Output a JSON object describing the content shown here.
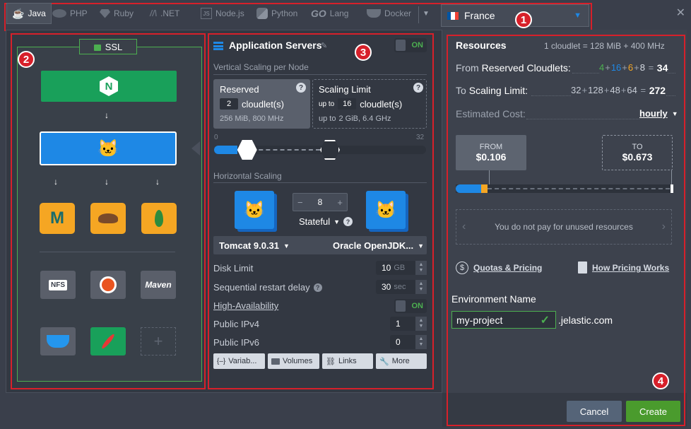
{
  "tabs": [
    {
      "label": "Java",
      "icon": "java-icon"
    },
    {
      "label": "PHP",
      "icon": "php-icon"
    },
    {
      "label": "Ruby",
      "icon": "ruby-icon"
    },
    {
      "label": ".NET",
      "icon": "dotnet-icon"
    },
    {
      "label": "Node.js",
      "icon": "nodejs-icon"
    },
    {
      "label": "Python",
      "icon": "python-icon"
    },
    {
      "label": "Lang",
      "icon": "go-icon",
      "logo": "GO"
    },
    {
      "label": "Docker",
      "icon": "docker-icon"
    }
  ],
  "region": {
    "label": "France",
    "flag_colors": [
      "#0055a4",
      "#ffffff",
      "#ef4135"
    ]
  },
  "badges": [
    "1",
    "2",
    "3",
    "4"
  ],
  "topology": {
    "ssl_label": "SSL",
    "nginx_letter": "N",
    "nfs_label": "NFS",
    "maven_label": "Maven",
    "add_symbol": "+"
  },
  "app_servers": {
    "title": "Application Servers",
    "toggle": "ON",
    "vertical_title": "Vertical Scaling per Node",
    "reserved": {
      "label": "Reserved",
      "count": "2",
      "unit": "cloudlet(s)",
      "details": "256 MiB, 800 MHz"
    },
    "scaling_limit": {
      "label": "Scaling Limit",
      "prefix": "up to",
      "count": "16",
      "unit": "cloudlet(s)",
      "details_prefix": "up to",
      "details": "2 GiB, 6.4 GHz"
    },
    "slider": {
      "min_label": "0",
      "max_label": "32",
      "reserved_value": 2,
      "limit_value": 16,
      "max": 32
    },
    "horizontal_title": "Horizontal Scaling",
    "node_count": "8",
    "mode": "Stateful",
    "server_version": "Tomcat 9.0.31",
    "jdk_version": "Oracle OpenJDK...",
    "disk_limit": {
      "label": "Disk Limit",
      "value": "10",
      "unit": "GB"
    },
    "restart_delay": {
      "label": "Sequential restart delay",
      "value": "30",
      "unit": "sec"
    },
    "ha": {
      "label": "High-Availability",
      "toggle": "ON"
    },
    "ipv4": {
      "label": "Public IPv4",
      "value": "1"
    },
    "ipv6": {
      "label": "Public IPv6",
      "value": "0"
    },
    "buttons": {
      "variables": "Variab...",
      "volumes": "Volumes",
      "links": "Links",
      "more": "More"
    }
  },
  "resources": {
    "title": "Resources",
    "cloudlet_def": "1 cloudlet = 128 MiB + 400 MHz",
    "from_label": "From",
    "from_label_strong": "Reserved Cloudlets:",
    "from_parts": [
      "4",
      "16",
      "6",
      "8"
    ],
    "from_total": "34",
    "from_colors": [
      "#4caf50",
      "#1e88e5",
      "#f5a623",
      "#d6dbe3"
    ],
    "to_label": "To",
    "to_label_strong": "Scaling Limit:",
    "to_parts": [
      "32",
      "128",
      "48",
      "64"
    ],
    "to_total": "272",
    "estimated_label": "Estimated Cost:",
    "period": "hourly",
    "from_box": {
      "label": "FROM",
      "value": "$0.106"
    },
    "to_box": {
      "label": "TO",
      "value": "$0.673"
    },
    "unused_note": "You do not pay for unused resources",
    "quotas_link": "Quotas & Pricing",
    "pricing_link": "How Pricing Works",
    "env_label": "Environment Name",
    "env_value": "my-project",
    "env_domain": ".jelastic.com"
  },
  "footer": {
    "cancel": "Cancel",
    "create": "Create"
  }
}
